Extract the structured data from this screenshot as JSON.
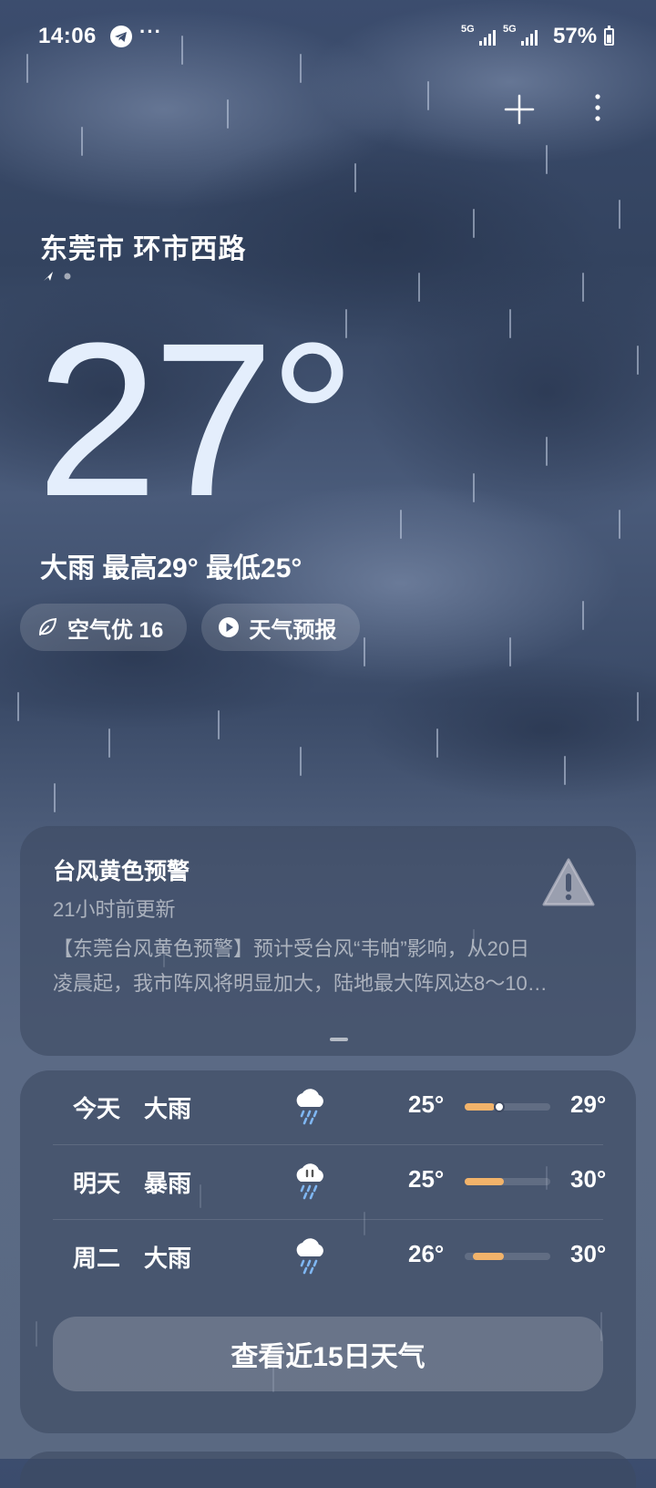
{
  "status_bar": {
    "time": "14:06",
    "app_icon": "telegram-icon",
    "more": "···",
    "sim1_label": "5G",
    "sim2_label": "5G",
    "battery_percent": "57%",
    "battery_level": 0.57
  },
  "toolbar": {
    "add_icon": "plus-icon",
    "menu_icon": "more-vertical-icon"
  },
  "current": {
    "location": "东莞市 环市西路",
    "temperature": "27°",
    "summary": "大雨  最高29° 最低25°"
  },
  "chips": {
    "air_label": "空气优 16",
    "air_icon": "leaf-icon",
    "forecast_label": "天气预报",
    "forecast_icon": "play-icon"
  },
  "alert": {
    "title": "台风黄色预警",
    "updated": "21小时前更新",
    "line1": "【东莞台风黄色预警】预计受台风“韦帕”影响，从20日",
    "line2": "凌晨起，我市阵风将明显加大，陆地最大阵风达8～10…",
    "icon": "warning-icon"
  },
  "forecast": {
    "rows": [
      {
        "day": "今天",
        "condition": "大雨",
        "icon": "heavy-rain-icon",
        "low": "25°",
        "high": "29°",
        "range_start": 0.0,
        "range_end": 0.35,
        "current_marker": 0.4
      },
      {
        "day": "明天",
        "condition": "暴雨",
        "icon": "rainstorm-icon",
        "low": "25°",
        "high": "30°",
        "range_start": 0.0,
        "range_end": 0.46
      },
      {
        "day": "周二",
        "condition": "大雨",
        "icon": "heavy-rain-icon",
        "low": "26°",
        "high": "30°",
        "range_start": 0.1,
        "range_end": 0.46
      }
    ],
    "more_button": "查看近15日天气"
  },
  "colors": {
    "temp_bar": "#f2b36a",
    "temperature_text": "#e4eefc"
  }
}
